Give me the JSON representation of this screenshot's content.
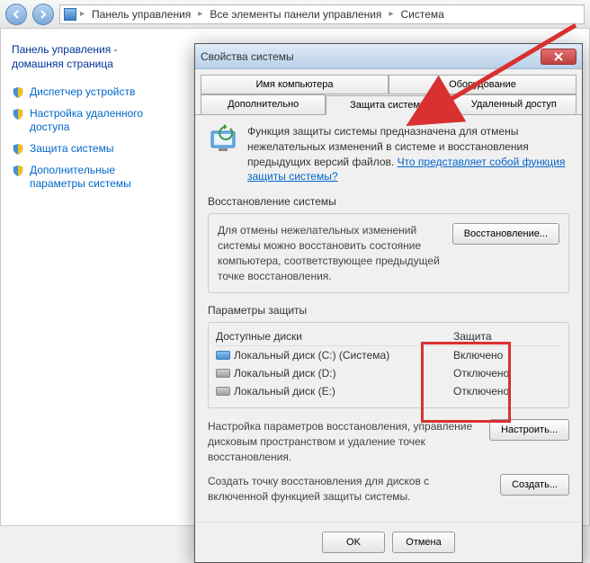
{
  "breadcrumb": {
    "item1": "Панель управления",
    "item2": "Все элементы панели управления",
    "item3": "Система"
  },
  "sidebar": {
    "title": "Панель управления - домашняя страница",
    "links": [
      "Диспетчер устройств",
      "Настройка удаленного доступа",
      "Защита системы",
      "Дополнительные параметры системы"
    ]
  },
  "dialog": {
    "title": "Свойства системы",
    "tabs_row1": [
      "Имя компьютера",
      "Оборудование"
    ],
    "tabs_row2": [
      "Дополнительно",
      "Защита системы",
      "Удаленный доступ"
    ],
    "info_text": "Функция защиты системы предназначена для отмены нежелательных изменений в системе и восстановления предыдущих версий файлов. ",
    "info_link": "Что представляет собой функция защиты системы?",
    "restore_section": "Восстановление системы",
    "restore_text": "Для отмены нежелательных изменений системы можно восстановить состояние компьютера, соответствующее предыдущей точке восстановления.",
    "restore_btn": "Восстановление...",
    "protect_section": "Параметры защиты",
    "headers": {
      "disk": "Доступные диски",
      "prot": "Защита"
    },
    "drives": [
      {
        "name": "Локальный диск (C:) (Система)",
        "status": "Включено",
        "sys": true
      },
      {
        "name": "Локальный диск (D:)",
        "status": "Отключено",
        "sys": false
      },
      {
        "name": "Локальный диск (E:)",
        "status": "Отключено",
        "sys": false
      }
    ],
    "cfg_text": "Настройка параметров восстановления, управление дисковым пространством и удаление точек восстановления.",
    "cfg_btn": "Настроить...",
    "create_text": "Создать точку восстановления для дисков с включенной функцией защиты системы.",
    "create_btn": "Создать...",
    "ok": "OK",
    "cancel": "Отмена"
  }
}
